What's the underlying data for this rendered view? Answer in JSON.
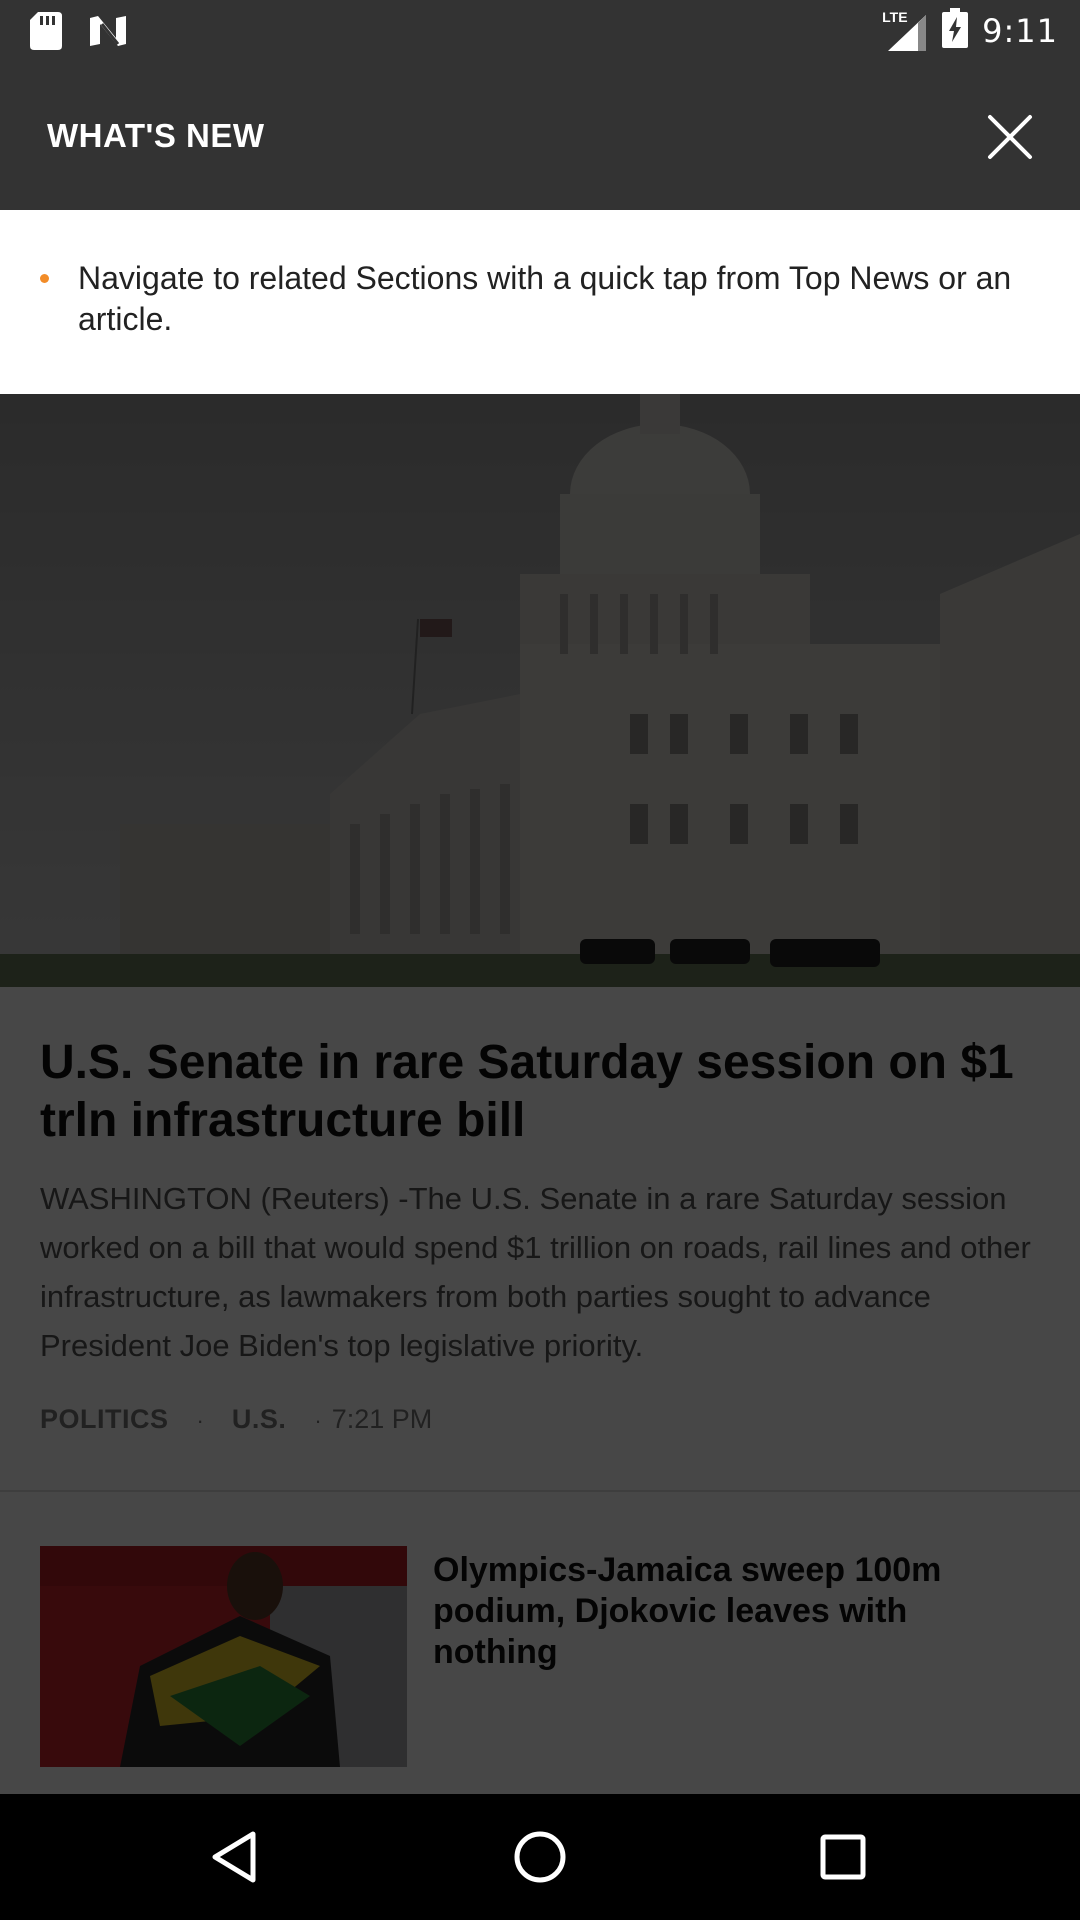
{
  "status_bar": {
    "network": "LTE",
    "time": "9:11",
    "icons": [
      "sd-card-icon",
      "n-logo-icon",
      "lte-signal-icon",
      "battery-charging-icon"
    ]
  },
  "whats_new": {
    "title": "WHAT'S NEW",
    "close_icon": "close-icon",
    "bullet_color": "#f28c28",
    "items": [
      "Navigate to related Sections with a quick tap from Top News or an article."
    ]
  },
  "feed": {
    "top_story": {
      "image": "capitol-building-photo",
      "headline": "U.S. Senate in rare Saturday session on $1 trln infrastructure bill",
      "summary": "WASHINGTON (Reuters) -The U.S. Senate in a rare Saturday session worked on a bill that would spend $1 trillion on roads, rail lines and other infrastructure, as lawmakers from both parties sought to advance President Joe Biden's top legislative priority.",
      "section_1": "POLITICS",
      "section_2": "U.S.",
      "separator": "·",
      "timestamp": "7:21 PM"
    },
    "second_story": {
      "image": "olympics-sprinter-photo",
      "headline": "Olympics-Jamaica sweep 100m podium, Djokovic leaves with nothing"
    }
  },
  "nav_bar": {
    "icons": [
      "back-icon",
      "home-icon",
      "recents-icon"
    ]
  }
}
